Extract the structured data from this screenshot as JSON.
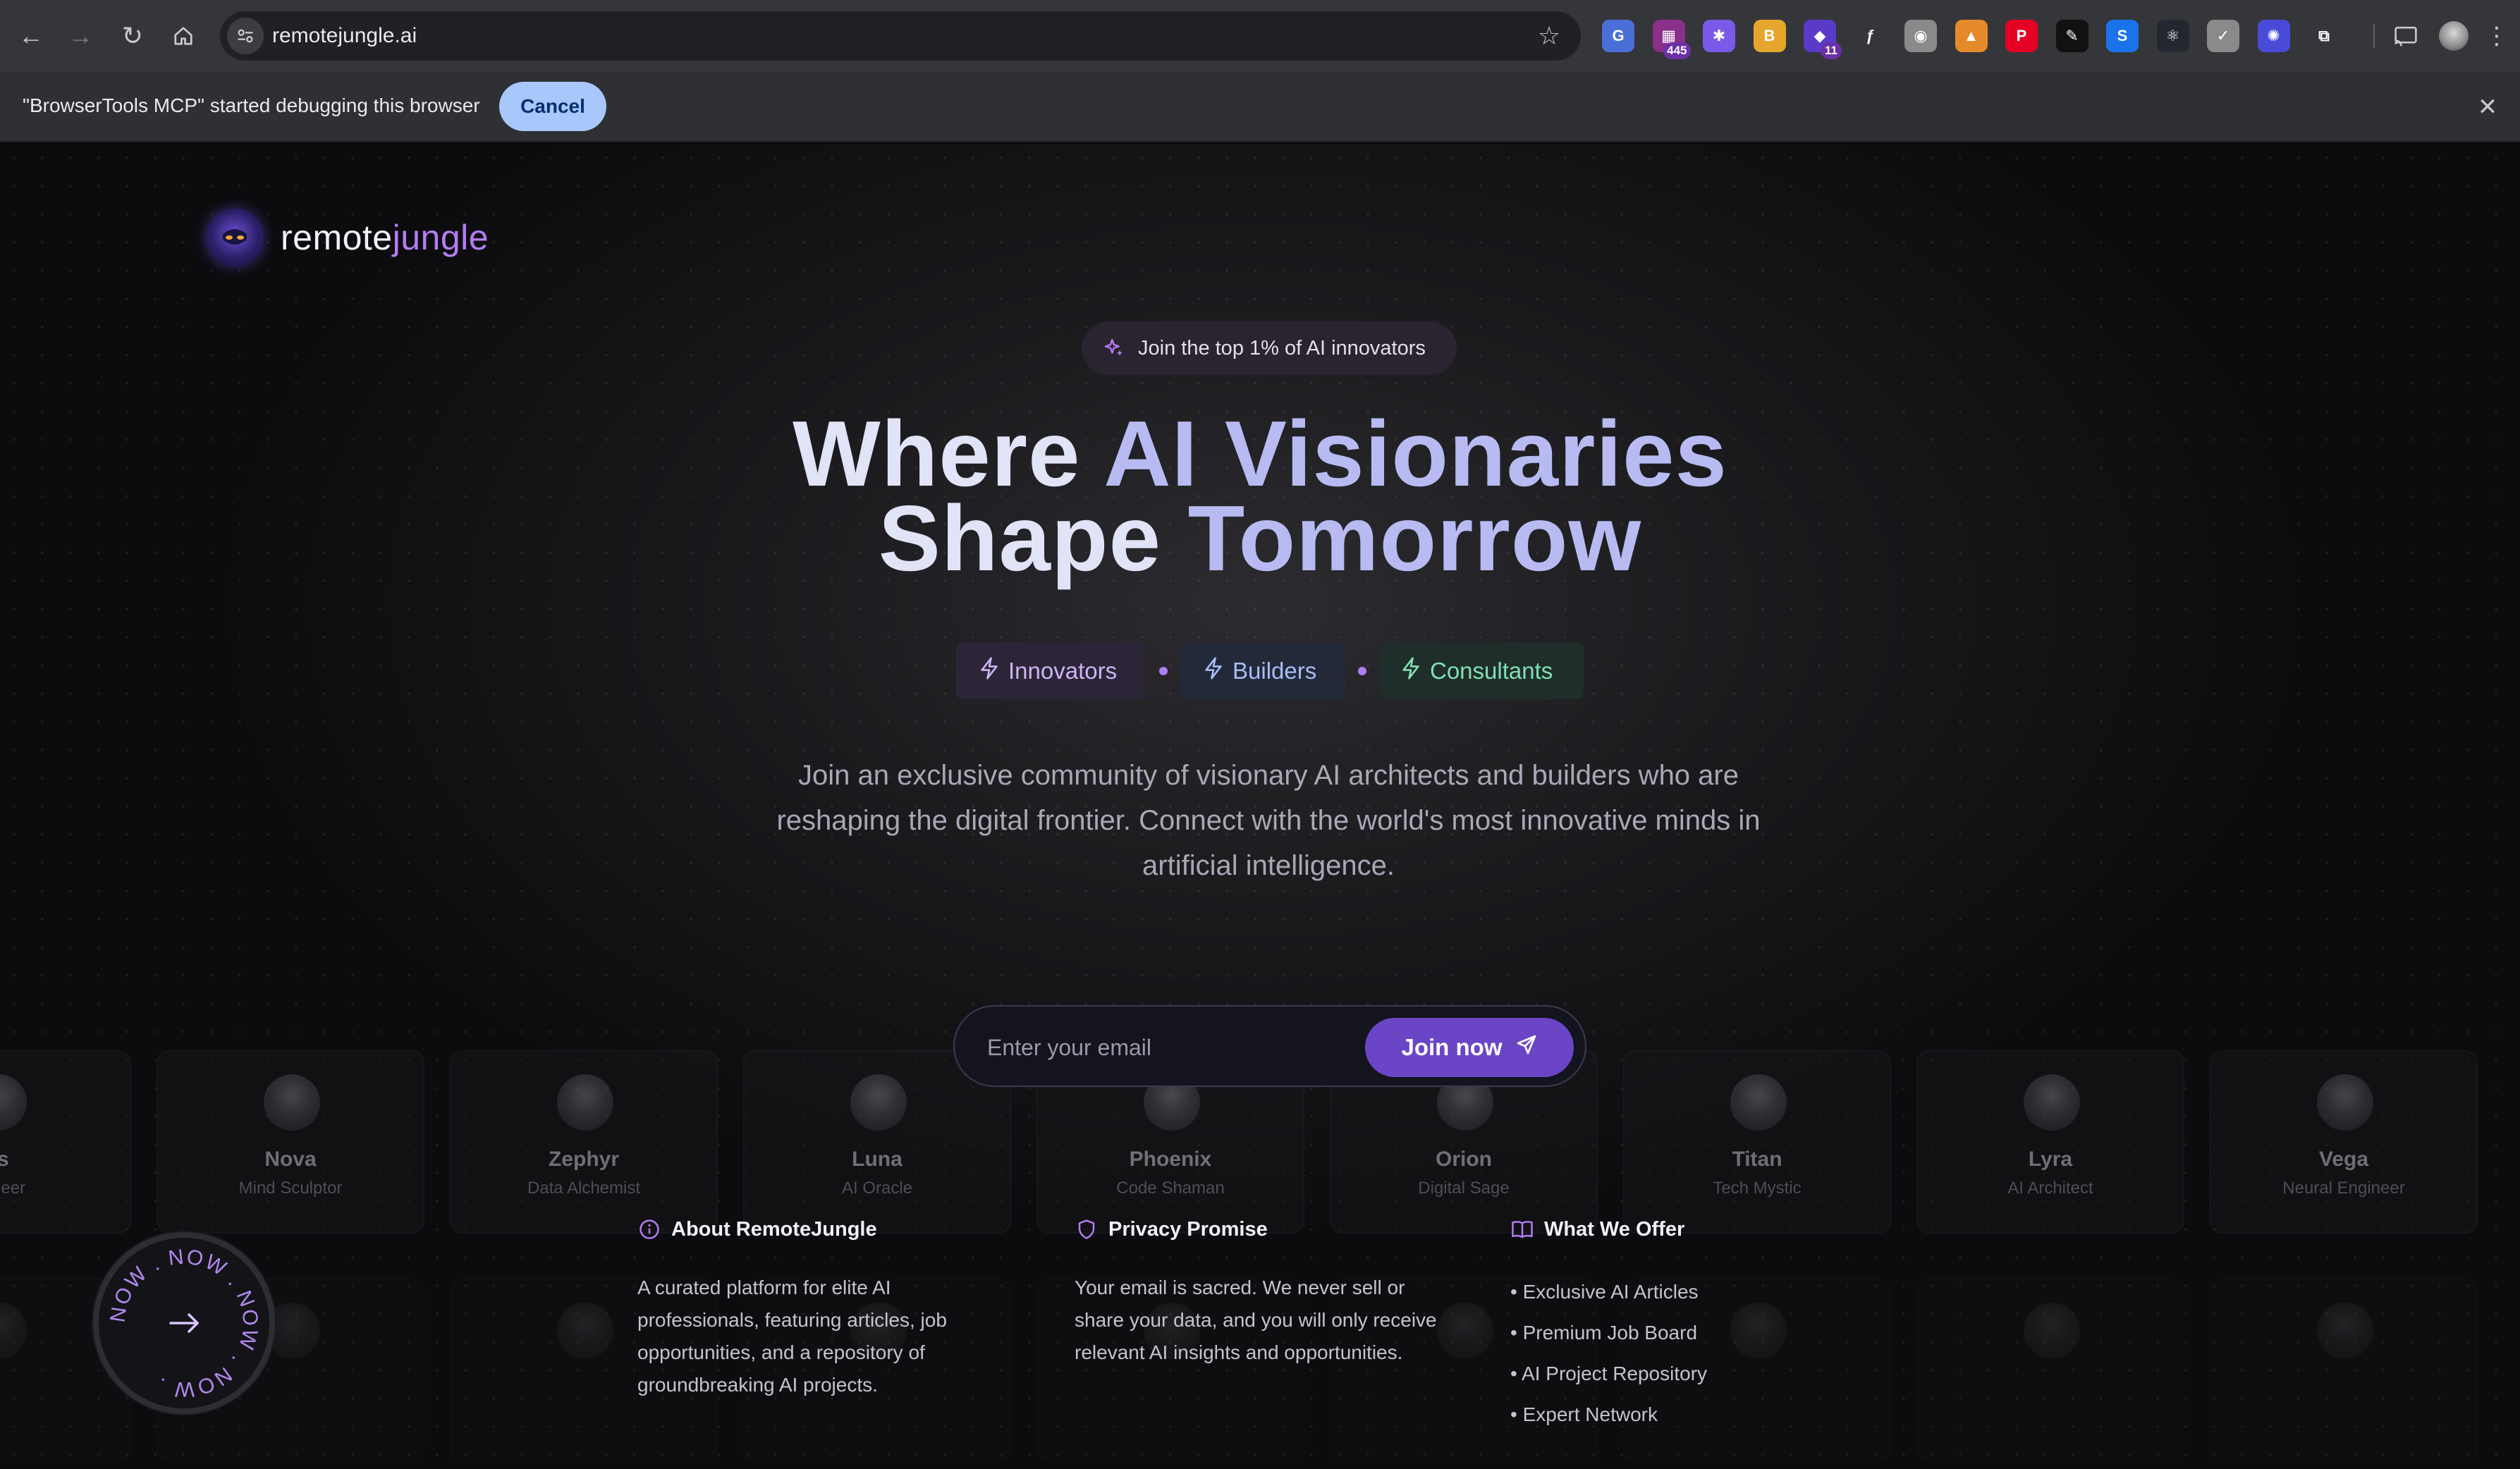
{
  "browser": {
    "url": "remotejungle.ai",
    "extensions": [
      {
        "icon": "translate-icon",
        "color": "#4a6fd8"
      },
      {
        "icon": "tabs-counter-icon",
        "color": "#8a2f8a",
        "badge": "445"
      },
      {
        "icon": "gear-extension-icon",
        "color": "#7a5ae8"
      },
      {
        "icon": "coin-extension-icon",
        "color": "#e5a62b"
      },
      {
        "icon": "purple-extension-icon",
        "color": "#5a3ac8",
        "badge": "11"
      },
      {
        "icon": "formula-extension-icon",
        "color": "#35363a"
      },
      {
        "icon": "owl-extension-icon",
        "color": "#8a8a8a"
      },
      {
        "icon": "triangle-extension-icon",
        "color": "#e58a2b"
      },
      {
        "icon": "pinterest-icon",
        "color": "#e60023"
      },
      {
        "icon": "eyedropper-icon",
        "color": "#111111"
      },
      {
        "icon": "s-extension-icon",
        "color": "#1a73e8"
      },
      {
        "icon": "react-devtools-icon",
        "color": "#23272f"
      },
      {
        "icon": "notes-extension-icon",
        "color": "#8a8a8a"
      },
      {
        "icon": "settings-extension-icon",
        "color": "#4a4ad8"
      },
      {
        "icon": "puzzle-icon",
        "color": "#35363a"
      }
    ]
  },
  "infobar": {
    "message": "\"BrowserTools MCP\" started debugging this browser",
    "cancel_label": "Cancel"
  },
  "logo": {
    "part1": "remote",
    "part2": "jungle"
  },
  "top_badge": "Join the top 1% of AI innovators",
  "headline": {
    "line1_a": "Where ",
    "line1_b": "AI Visionaries",
    "line2_a": "Shape ",
    "line2_b": "Tomorrow"
  },
  "pills": [
    "Innovators",
    "Builders",
    "Consultants"
  ],
  "description": "Join an exclusive community of visionary AI architects and builders who are reshaping the digital frontier. Connect with the world's most innovative minds in artificial intelligence.",
  "email": {
    "placeholder": "Enter your email",
    "value": "",
    "button_label": "Join now"
  },
  "profiles": [
    {
      "name": "as",
      "role": "ngineer"
    },
    {
      "name": "Nova",
      "role": "Mind Sculptor"
    },
    {
      "name": "Zephyr",
      "role": "Data Alchemist"
    },
    {
      "name": "Luna",
      "role": "AI Oracle"
    },
    {
      "name": "Phoenix",
      "role": "Code Shaman"
    },
    {
      "name": "Orion",
      "role": "Digital Sage"
    },
    {
      "name": "Titan",
      "role": "Tech Mystic"
    },
    {
      "name": "Lyra",
      "role": "AI Architect"
    },
    {
      "name": "Vega",
      "role": "Neural Engineer"
    }
  ],
  "about": {
    "title": "About RemoteJungle",
    "body": "A curated platform for elite AI professionals, featuring articles, job opportunities, and a repository of groundbreaking AI projects."
  },
  "privacy": {
    "title": "Privacy Promise",
    "body": "Your email is sacred. We never sell or share your data, and you will only receive relevant AI insights and opportunities."
  },
  "offer": {
    "title": "What We Offer",
    "items": [
      "• Exclusive AI Articles",
      "• Premium Job Board",
      "• AI Project Repository",
      "• Expert Network"
    ]
  },
  "now_badge": {
    "text": "NOW . NOW . NOW . NOW . "
  }
}
